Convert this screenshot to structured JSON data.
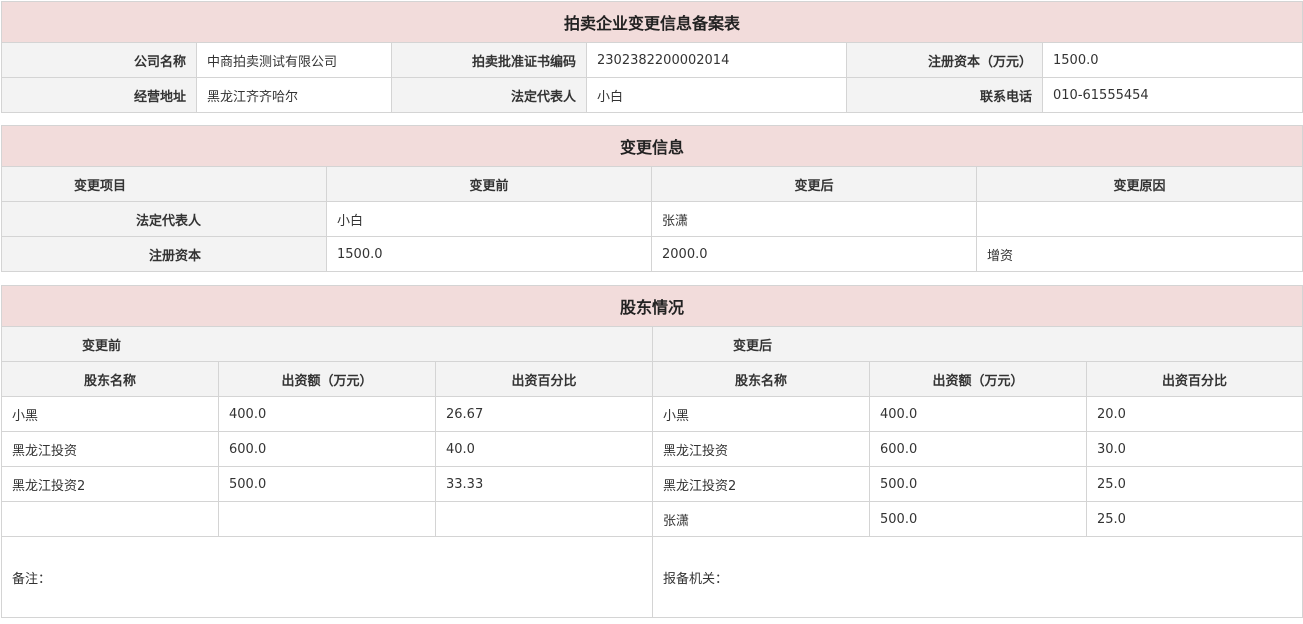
{
  "basic": {
    "title": "拍卖企业变更信息备案表",
    "rows": [
      [
        {
          "label": "公司名称",
          "value": "中商拍卖测试有限公司"
        },
        {
          "label": "拍卖批准证书编码",
          "value": "2302382200002014"
        },
        {
          "label": "注册资本（万元）",
          "value": "1500.0"
        }
      ],
      [
        {
          "label": "经营地址",
          "value": "黑龙江齐齐哈尔"
        },
        {
          "label": "法定代表人",
          "value": "小白"
        },
        {
          "label": "联系电话",
          "value": "010-61555454"
        }
      ]
    ]
  },
  "changes": {
    "title": "变更信息",
    "headers": [
      "变更项目",
      "变更前",
      "变更后",
      "变更原因"
    ],
    "rows": [
      {
        "item": "法定代表人",
        "before": "小白",
        "after": "张潇",
        "reason": ""
      },
      {
        "item": "注册资本",
        "before": "1500.0",
        "after": "2000.0",
        "reason": "增资"
      }
    ]
  },
  "shareholders": {
    "title": "股东情况",
    "before_label": "变更前",
    "after_label": "变更后",
    "headers": [
      "股东名称",
      "出资额（万元）",
      "出资百分比",
      "股东名称",
      "出资额（万元）",
      "出资百分比"
    ],
    "rows": [
      [
        "小黑",
        "400.0",
        "26.67",
        "小黑",
        "400.0",
        "20.0"
      ],
      [
        "黑龙江投资",
        "600.0",
        "40.0",
        "黑龙江投资",
        "600.0",
        "30.0"
      ],
      [
        "黑龙江投资2",
        "500.0",
        "33.33",
        "黑龙江投资2",
        "500.0",
        "25.0"
      ],
      [
        "",
        "",
        "",
        "张潇",
        "500.0",
        "25.0"
      ]
    ],
    "remark_label": "备注：",
    "authority_label": "报备机关："
  }
}
